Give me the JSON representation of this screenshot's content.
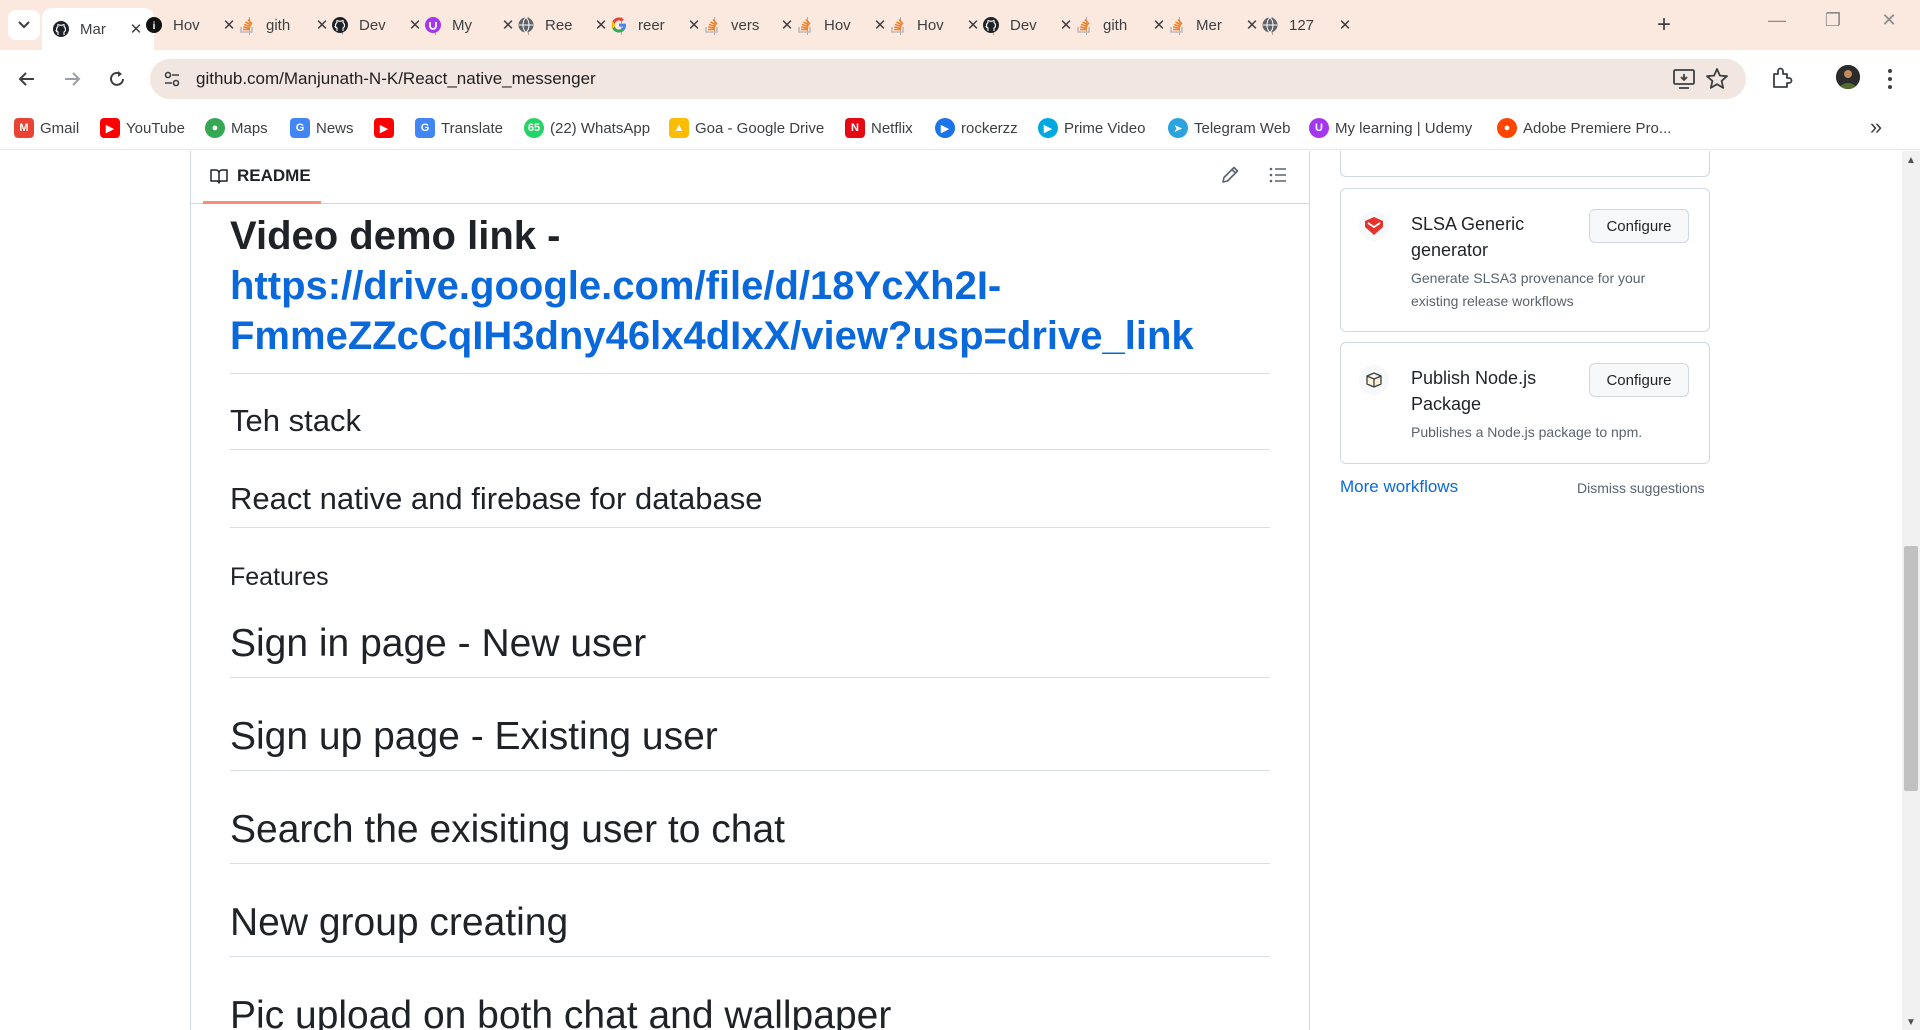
{
  "tabs": [
    {
      "title": "Manjunath-N-K/React_native_messenger",
      "short": "Mar",
      "icon": "github-icon",
      "active": true
    },
    {
      "title": "How",
      "short": "Hov",
      "icon": "medium-icon"
    },
    {
      "title": "github",
      "short": "gith",
      "icon": "stackoverflow-icon"
    },
    {
      "title": "Dev",
      "short": "Dev",
      "icon": "github-icon"
    },
    {
      "title": "My",
      "short": "My",
      "icon": "udemy-icon"
    },
    {
      "title": "Ree",
      "short": "Ree",
      "icon": "globe-icon"
    },
    {
      "title": "reer",
      "short": "reer",
      "icon": "google-icon"
    },
    {
      "title": "vers",
      "short": "vers",
      "icon": "stackoverflow-icon"
    },
    {
      "title": "How",
      "short": "Hov",
      "icon": "stackoverflow-icon"
    },
    {
      "title": "How",
      "short": "Hov",
      "icon": "stackoverflow-icon"
    },
    {
      "title": "Dev",
      "short": "Dev",
      "icon": "github-icon"
    },
    {
      "title": "gith",
      "short": "gith",
      "icon": "stackoverflow-icon"
    },
    {
      "title": "Mer",
      "short": "Mer",
      "icon": "stackoverflow-icon"
    },
    {
      "title": "127",
      "short": "127",
      "icon": "globe-icon"
    }
  ],
  "toolbar": {
    "url": "github.com/Manjunath-N-K/React_native_messenger"
  },
  "bookmarks": [
    {
      "label": "Gmail",
      "icon": "gmail-icon",
      "color": "#ea4335"
    },
    {
      "label": "YouTube",
      "icon": "youtube-icon",
      "color": "#ff0000"
    },
    {
      "label": "Maps",
      "icon": "maps-icon",
      "color": "#34a853"
    },
    {
      "label": "News",
      "icon": "news-icon",
      "color": "#4285f4"
    },
    {
      "label": "",
      "icon": "youtube-icon",
      "color": "#ff0000"
    },
    {
      "label": "Translate",
      "icon": "translate-icon",
      "color": "#4285f4"
    },
    {
      "label": "(22) WhatsApp",
      "icon": "whatsapp-icon",
      "color": "#25d366"
    },
    {
      "label": "Goa - Google Drive",
      "icon": "drive-icon",
      "color": "#fbbc04"
    },
    {
      "label": "Netflix",
      "icon": "netflix-icon",
      "color": "#e50914"
    },
    {
      "label": "rockerzz",
      "icon": "play-icon",
      "color": "#1a73e8"
    },
    {
      "label": "Prime Video",
      "icon": "prime-icon",
      "color": "#00a8e1"
    },
    {
      "label": "Telegram Web",
      "icon": "telegram-icon",
      "color": "#2aa3df"
    },
    {
      "label": "My learning | Udemy",
      "icon": "udemy-icon",
      "color": "#a435f0"
    },
    {
      "label": "Adobe Premiere Pro...",
      "icon": "reddit-icon",
      "color": "#ff4500"
    }
  ],
  "readme": {
    "tab_label": "README",
    "video_heading_prefix": "Video demo link - ",
    "video_link_line1": "https://drive.google.com/file/d/18YcXh2I-",
    "video_link_line2": "FmmeZZcCqIH3dny46lx4dIxX/view?usp=drive_link",
    "stack": "Teh stack",
    "react": "React native and firebase for database",
    "features": "Features",
    "signin": "Sign in page - New user",
    "signup": "Sign up page - Existing user",
    "search": "Search the exisiting user to chat",
    "group": "New group creating",
    "pic": "Pic upload on both chat and wallpaper"
  },
  "sidebar": {
    "workflows": [
      {
        "name": "SLSA Generic generator",
        "desc": "Generate SLSA3 provenance for your existing release workflows",
        "button": "Configure",
        "icon": "slsa-icon"
      },
      {
        "name": "Publish Node.js Package",
        "desc": "Publishes a Node.js package to npm.",
        "button": "Configure",
        "icon": "package-icon"
      }
    ],
    "more_workflows": "More workflows",
    "dismiss": "Dismiss suggestions"
  }
}
